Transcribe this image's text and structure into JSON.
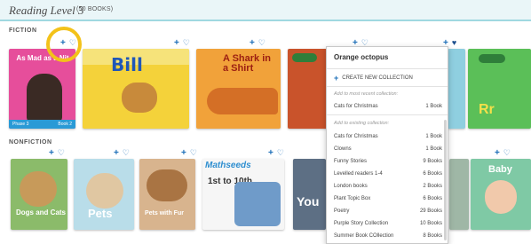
{
  "header": {
    "title": "Reading Level 3",
    "count": "(50 BOOKS)"
  },
  "sections": {
    "fiction": "FICTION",
    "nonfiction": "NONFICTION"
  },
  "icons": {
    "add": "plus-icon",
    "favorite": "heart-icon"
  },
  "colors": {
    "accent": "#1d6fb8",
    "highlight_ring": "#f3c21a",
    "header_bg": "#eaf6f8"
  },
  "fiction_books": [
    {
      "title": "As Mad as a Nit",
      "footer_left": "Phase 3",
      "footer_right": "Book 2"
    },
    {
      "title": "Bill"
    },
    {
      "title": "A Shark in a Shirt"
    },
    {
      "title": ""
    },
    {
      "title": ""
    },
    {
      "title": "Rr"
    }
  ],
  "nonfiction_books": [
    {
      "title": "Dogs and Cats"
    },
    {
      "title": "Pets"
    },
    {
      "title": "Pets with Fur"
    },
    {
      "title": "1st to 10th",
      "series": "Mathseeds"
    },
    {
      "title": "You"
    },
    {
      "title": ""
    },
    {
      "title": "Baby"
    }
  ],
  "popup": {
    "title": "Orange octopus",
    "create_label": "CREATE NEW COLLECTION",
    "recent_hint": "Add to most recent collection:",
    "recent": {
      "name": "Cats for Christmas",
      "count": "1 Book"
    },
    "existing_hint": "Add to existing collection:",
    "collections": [
      {
        "name": "Cats for Christmas",
        "count": "1 Book"
      },
      {
        "name": "Clowns",
        "count": "1 Book"
      },
      {
        "name": "Funny Stories",
        "count": "9 Books"
      },
      {
        "name": "Levelled readers 1-4",
        "count": "6 Books"
      },
      {
        "name": "London books",
        "count": "2 Books"
      },
      {
        "name": "Plant Topic Box",
        "count": "6 Books"
      },
      {
        "name": "Poetry",
        "count": "29 Books"
      },
      {
        "name": "Purple Story Collection",
        "count": "10 Books"
      },
      {
        "name": "Summer Book COllection",
        "count": "8 Books"
      }
    ]
  }
}
